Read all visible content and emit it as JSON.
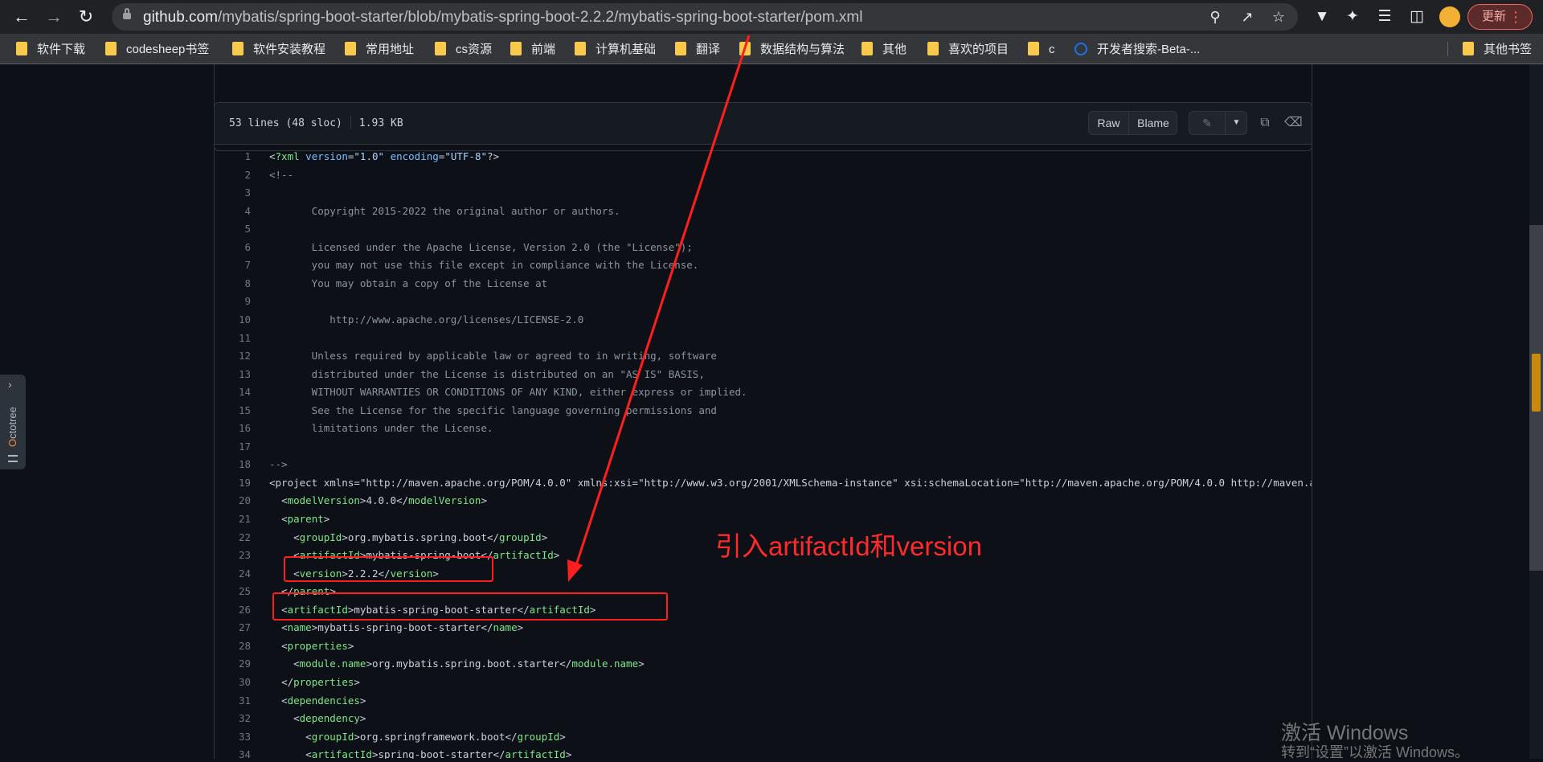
{
  "browser": {
    "url_domain": "github.com",
    "url_path": "/mybatis/spring-boot-starter/blob/mybatis-spring-boot-2.2.2/mybatis-spring-boot-starter/pom.xml",
    "update_label": "更新",
    "bookmarks": [
      "软件下载",
      "codesheep书签",
      "软件安装教程",
      "常用地址",
      "cs资源",
      "前端",
      "计算机基础",
      "翻译",
      "数据结构与算法",
      "其他",
      "喜欢的项目",
      "c",
      "开发者搜索-Beta-...",
      "其他书签"
    ]
  },
  "file": {
    "lines_info": "53 lines (48 sloc)",
    "size": "1.93 KB",
    "raw_label": "Raw",
    "blame_label": "Blame"
  },
  "code_lines": [
    {
      "n": "1",
      "t": "<?xml version=\"1.0\" encoding=\"UTF-8\"?>"
    },
    {
      "n": "2",
      "t": "<!--"
    },
    {
      "n": "3",
      "t": ""
    },
    {
      "n": "4",
      "t": "       Copyright 2015-2022 the original author or authors."
    },
    {
      "n": "5",
      "t": ""
    },
    {
      "n": "6",
      "t": "       Licensed under the Apache License, Version 2.0 (the \"License\");"
    },
    {
      "n": "7",
      "t": "       you may not use this file except in compliance with the License."
    },
    {
      "n": "8",
      "t": "       You may obtain a copy of the License at"
    },
    {
      "n": "9",
      "t": ""
    },
    {
      "n": "10",
      "t": "          http://www.apache.org/licenses/LICENSE-2.0"
    },
    {
      "n": "11",
      "t": ""
    },
    {
      "n": "12",
      "t": "       Unless required by applicable law or agreed to in writing, software"
    },
    {
      "n": "13",
      "t": "       distributed under the License is distributed on an \"AS IS\" BASIS,"
    },
    {
      "n": "14",
      "t": "       WITHOUT WARRANTIES OR CONDITIONS OF ANY KIND, either express or implied."
    },
    {
      "n": "15",
      "t": "       See the License for the specific language governing permissions and"
    },
    {
      "n": "16",
      "t": "       limitations under the License."
    },
    {
      "n": "17",
      "t": ""
    },
    {
      "n": "18",
      "t": "-->"
    },
    {
      "n": "19",
      "t": "<project xmlns=\"http://maven.apache.org/POM/4.0.0\" xmlns:xsi=\"http://www.w3.org/2001/XMLSchema-instance\" xsi:schemaLocation=\"http://maven.apache.org/POM/4.0.0 http://maven.apa"
    },
    {
      "n": "20",
      "t": "  <modelVersion>4.0.0</modelVersion>"
    },
    {
      "n": "21",
      "t": "  <parent>"
    },
    {
      "n": "22",
      "t": "    <groupId>org.mybatis.spring.boot</groupId>"
    },
    {
      "n": "23",
      "t": "    <artifactId>mybatis-spring-boot</artifactId>"
    },
    {
      "n": "24",
      "t": "    <version>2.2.2</version>"
    },
    {
      "n": "25",
      "t": "  </parent>"
    },
    {
      "n": "26",
      "t": "  <artifactId>mybatis-spring-boot-starter</artifactId>"
    },
    {
      "n": "27",
      "t": "  <name>mybatis-spring-boot-starter</name>"
    },
    {
      "n": "28",
      "t": "  <properties>"
    },
    {
      "n": "29",
      "t": "    <module.name>org.mybatis.spring.boot.starter</module.name>"
    },
    {
      "n": "30",
      "t": "  </properties>"
    },
    {
      "n": "31",
      "t": "  <dependencies>"
    },
    {
      "n": "32",
      "t": "    <dependency>"
    },
    {
      "n": "33",
      "t": "      <groupId>org.springframework.boot</groupId>"
    },
    {
      "n": "34",
      "t": "      <artifactId>spring-boot-starter</artifactId>"
    }
  ],
  "annotation": {
    "text": "引入artifactId和version"
  },
  "octotree": {
    "label": "Octotree"
  },
  "watermark": {
    "line1": "激活 Windows",
    "line2": "转到“设置”以激活 Windows。"
  },
  "colors": {
    "annotation_red": "#ff1e1e",
    "code_tag": "#7ee787",
    "code_attr": "#79c0ff",
    "code_string": "#a5d6ff",
    "code_comment": "#8b949e"
  }
}
